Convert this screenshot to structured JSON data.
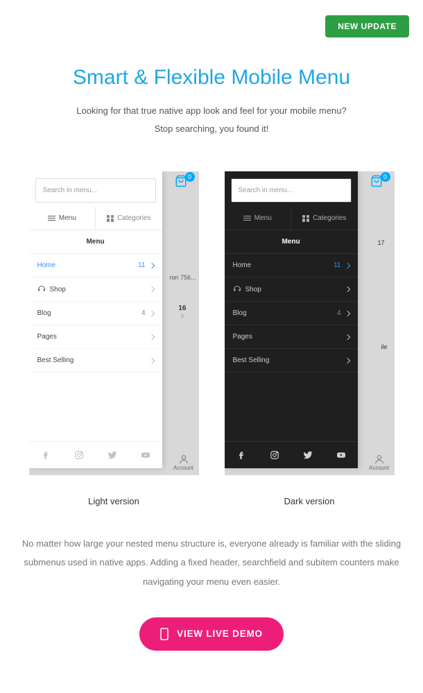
{
  "badge": "NEW UPDATE",
  "title": "Smart & Flexible Mobile Menu",
  "subtitle_1": "Looking for that true native app look and feel for your mobile menu?",
  "subtitle_2": "Stop searching, you found it!",
  "search_placeholder": "Search in menu...",
  "cart_count": "0",
  "tabs": {
    "menu": "Menu",
    "categories": "Categories"
  },
  "menu_header": "Menu",
  "items": [
    {
      "label": "Home",
      "count": "11",
      "highlight": true
    },
    {
      "label": "Shop",
      "count": "",
      "icon": true
    },
    {
      "label": "Blog",
      "count": "4"
    },
    {
      "label": "Pages",
      "count": ""
    },
    {
      "label": "Best Selling",
      "count": ""
    }
  ],
  "account_label": "Account",
  "version_light": "Light version",
  "version_dark": "Dark version",
  "description": "No matter how large your nested menu structure is, everyone already is familiar with the sliding submenus used in native apps. Adding a fixed header, searchfield and subitem counters make navigating your menu even easier.",
  "cta": "VIEW LIVE DEMO",
  "bg_hints": {
    "light_row2": "ron 756...",
    "light_row3_num": "16",
    "light_row3_s": "s",
    "dark_row1": "17",
    "dark_row3": "ile"
  }
}
